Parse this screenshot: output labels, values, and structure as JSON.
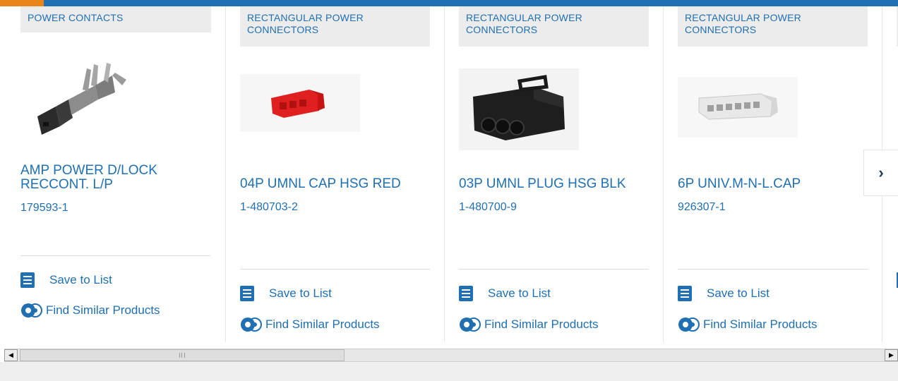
{
  "colors": {
    "accent_blue": "#1f6fb2",
    "accent_orange": "#e8841a",
    "category_bg": "#ececec"
  },
  "products": [
    {
      "category": "POWER CONTACTS",
      "name": "AMP POWER D/LOCK RECCONT. L/P",
      "part_number": "179593-1",
      "save_label": "Save to List",
      "similar_label": "Find Similar Products"
    },
    {
      "category": "RECTANGULAR POWER CONNECTORS",
      "name": "04P UMNL CAP HSG RED",
      "part_number": "1-480703-2",
      "save_label": "Save to List",
      "similar_label": "Find Similar Products"
    },
    {
      "category": "RECTANGULAR POWER CONNECTORS",
      "name": "03P UMNL PLUG HSG BLK",
      "part_number": "1-480700-9",
      "save_label": "Save to List",
      "similar_label": "Find Similar Products"
    },
    {
      "category": "RECTANGULAR POWER CONNECTORS",
      "name": "6P UNIV.M-N-L.CAP",
      "part_number": "926307-1",
      "save_label": "Save to List",
      "similar_label": "Find Similar Products"
    }
  ],
  "carousel": {
    "next_icon": "chevron-right-icon",
    "next_glyph": "›"
  },
  "scrollbar": {
    "left_arrow": "◀",
    "right_arrow": "▶"
  }
}
